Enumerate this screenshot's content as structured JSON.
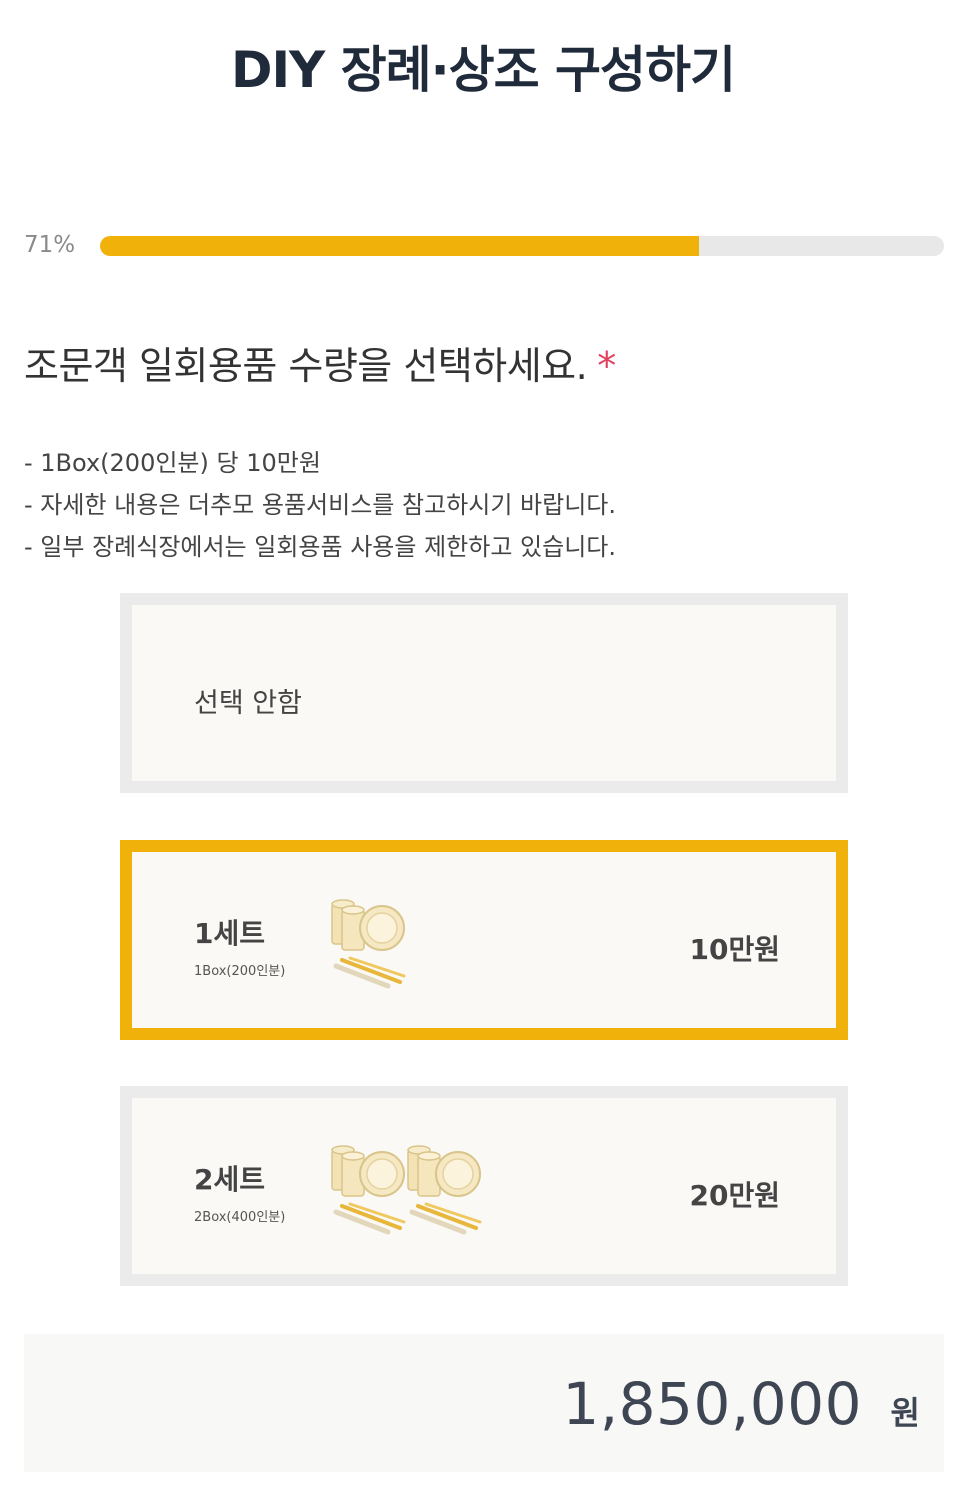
{
  "header": {
    "title": "DIY 장례·상조 구성하기"
  },
  "progress": {
    "label": "71%",
    "value": 0.71
  },
  "question": {
    "text": "조문객 일회용품 수량을 선택하세요.",
    "required_mark": "*"
  },
  "notes": [
    "- 1Box(200인분) 당 10만원",
    "- 자세한 내용은 더추모 용품서비스를 참고하시기 바랍니다.",
    "- 일부 장례식장에서는 일회용품 사용을 제한하고 있습니다."
  ],
  "options": [
    {
      "label": "선택 안함"
    },
    {
      "title": "1세트",
      "subtitle": "1Box(200인분)",
      "price": "10만원",
      "selected": true
    },
    {
      "title": "2세트",
      "subtitle": "2Box(400인분)",
      "price": "20만원",
      "selected": false
    }
  ],
  "total": {
    "amount": "1,850,000",
    "unit": "원"
  },
  "colors": {
    "accent": "#f0b10b",
    "required": "#e0415f",
    "title": "#1f2a3a"
  },
  "icons": [
    "disposable-tableware-icon"
  ]
}
